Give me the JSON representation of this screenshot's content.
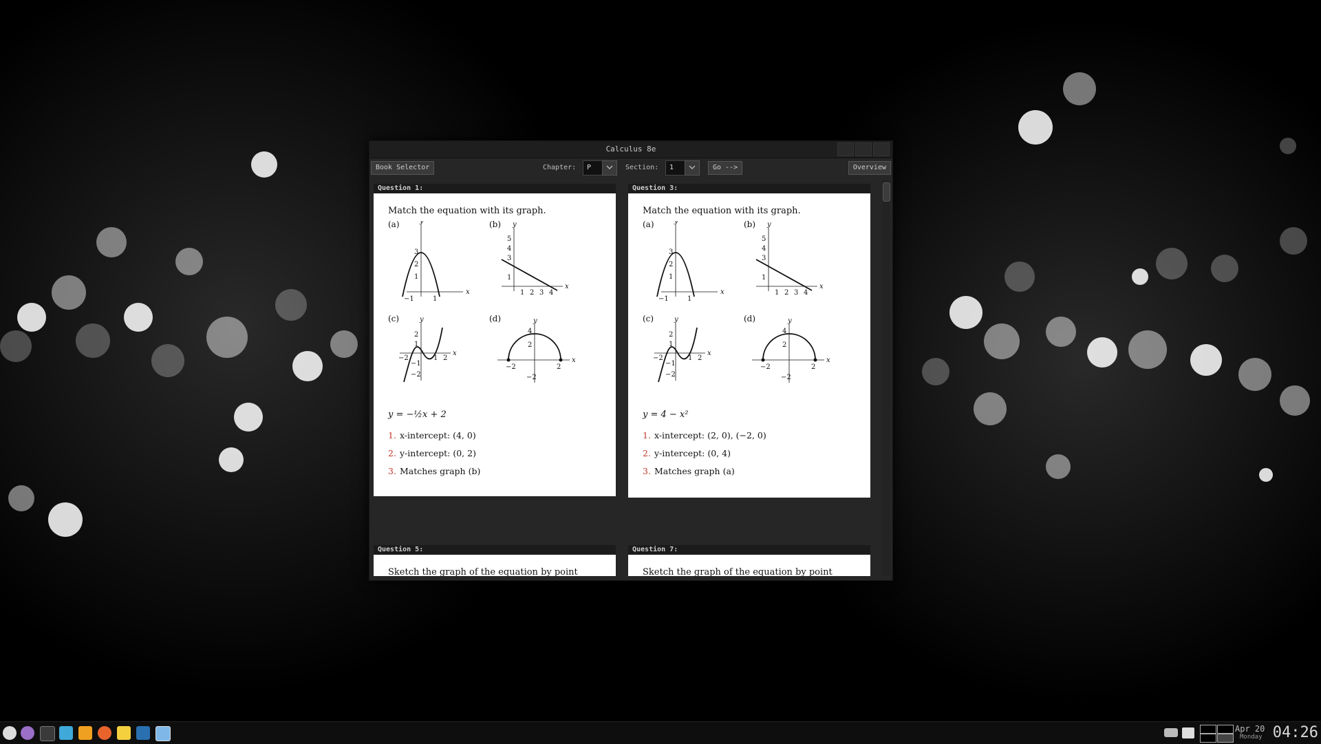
{
  "window": {
    "title": "Calculus 8e"
  },
  "toolbar": {
    "book_selector": "Book Selector",
    "chapter_label": "Chapter:",
    "chapter_value": "P",
    "section_label": "Section:",
    "section_value": "1",
    "go": "Go -->",
    "overview": "Overview"
  },
  "questions": [
    {
      "label": "Question 1:",
      "instruction": "Match the equation with its graph.",
      "equation": "y = −½x + 2",
      "steps": [
        {
          "num": "1.",
          "text": "x-intercept:  (4, 0)"
        },
        {
          "num": "2.",
          "text": "y-intercept:  (0, 2)"
        },
        {
          "num": "3.",
          "text": "Matches graph (b)"
        }
      ]
    },
    {
      "label": "Question 3:",
      "instruction": "Match the equation with its graph.",
      "equation": "y = 4 − x²",
      "steps": [
        {
          "num": "1.",
          "text": "x-intercept:  (2, 0),  (−2, 0)"
        },
        {
          "num": "2.",
          "text": "y-intercept:  (0, 4)"
        },
        {
          "num": "3.",
          "text": "Matches graph (a)"
        }
      ]
    },
    {
      "label": "Question 5:",
      "instruction": "Sketch the graph of the equation by point plotting."
    },
    {
      "label": "Question 7:",
      "instruction": "Sketch the graph of the equation by point plotting."
    }
  ],
  "graph_text": {
    "a": "(a)",
    "b": "(b)",
    "c": "(c)",
    "d": "(d)",
    "x": "x",
    "y": "y",
    "n1": "1",
    "n2": "2",
    "n3": "3",
    "n4": "4",
    "n5": "5",
    "m1": "−1",
    "m2": "−2"
  },
  "taskbar": {
    "date": "Apr 20",
    "day": "Monday",
    "time": "04:26"
  },
  "colors": {
    "step_number": "#c0392b",
    "window_bg": "#262626"
  }
}
